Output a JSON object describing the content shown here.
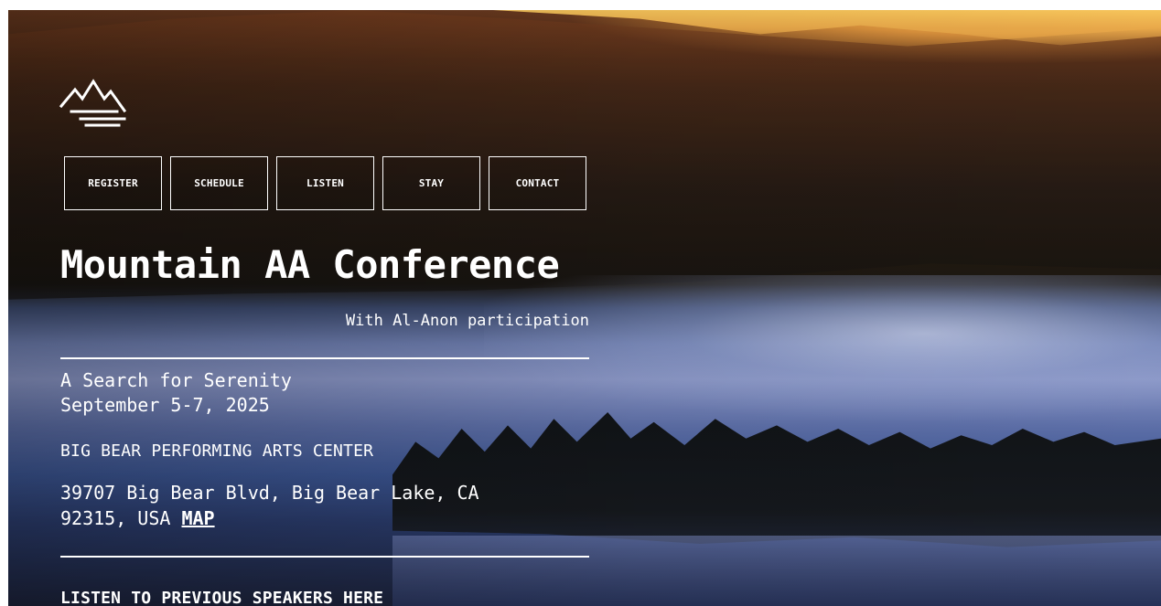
{
  "nav": {
    "items": [
      {
        "label": "REGISTER"
      },
      {
        "label": "SCHEDULE"
      },
      {
        "label": "LISTEN"
      },
      {
        "label": "STAY"
      },
      {
        "label": "CONTACT"
      }
    ]
  },
  "hero": {
    "title": "Mountain AA Conference",
    "subtitle": "With Al-Anon participation",
    "theme": "A Search for Serenity",
    "dates": "September 5-7, 2025",
    "venue": "BIG BEAR PERFORMING ARTS CENTER",
    "address": "39707 Big Bear Blvd, Big Bear Lake, CA 92315, USA",
    "map_label": "MAP",
    "listen_cta": "LISTEN TO PREVIOUS SPEAKERS HERE"
  },
  "icons": {
    "logo": "mountain-logo-icon"
  },
  "colors": {
    "text": "#ffffff",
    "sky_glow": "#f6c45a",
    "lake": "#8a96c6"
  }
}
